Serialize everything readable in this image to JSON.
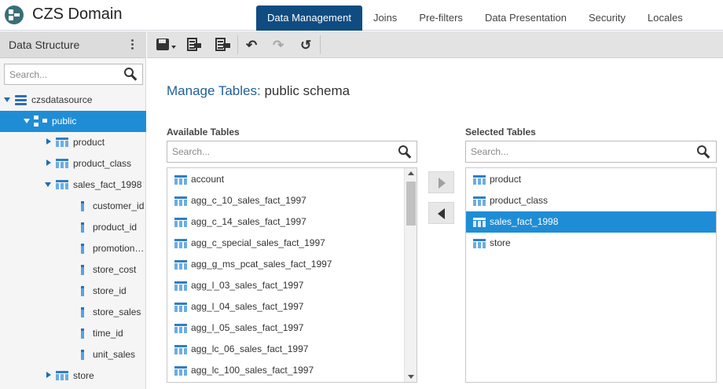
{
  "app": {
    "title": "CZS Domain"
  },
  "tabs": [
    {
      "label": "Data Management",
      "active": true
    },
    {
      "label": "Joins",
      "active": false
    },
    {
      "label": "Pre-filters",
      "active": false
    },
    {
      "label": "Data Presentation",
      "active": false
    },
    {
      "label": "Security",
      "active": false
    },
    {
      "label": "Locales",
      "active": false
    }
  ],
  "sidebar": {
    "title": "Data Structure",
    "search_placeholder": "Search...",
    "tree": [
      {
        "label": "czsdatasource",
        "type": "datasource",
        "expanded": true
      },
      {
        "label": "public",
        "type": "schema",
        "expanded": true,
        "selected": true
      },
      {
        "label": "product",
        "type": "table",
        "expanded": false
      },
      {
        "label": "product_class",
        "type": "table",
        "expanded": false
      },
      {
        "label": "sales_fact_1998",
        "type": "table",
        "expanded": true
      },
      {
        "label": "customer_id",
        "type": "column"
      },
      {
        "label": "product_id",
        "type": "column"
      },
      {
        "label": "promotion_id",
        "type": "column"
      },
      {
        "label": "store_cost",
        "type": "column"
      },
      {
        "label": "store_id",
        "type": "column"
      },
      {
        "label": "store_sales",
        "type": "column"
      },
      {
        "label": "time_id",
        "type": "column"
      },
      {
        "label": "unit_sales",
        "type": "column"
      },
      {
        "label": "store",
        "type": "table",
        "expanded": false
      }
    ]
  },
  "toolbar": {
    "buttons": [
      "save-icon",
      "export-icon",
      "import-icon",
      "undo-icon",
      "redo-icon",
      "revert-icon"
    ]
  },
  "main": {
    "title_key": "Manage Tables:",
    "title_value": "public schema",
    "available": {
      "label": "Available Tables",
      "search_placeholder": "Search...",
      "items": [
        "account",
        "agg_c_10_sales_fact_1997",
        "agg_c_14_sales_fact_1997",
        "agg_c_special_sales_fact_1997",
        "agg_g_ms_pcat_sales_fact_1997",
        "agg_l_03_sales_fact_1997",
        "agg_l_04_sales_fact_1997",
        "agg_l_05_sales_fact_1997",
        "agg_lc_06_sales_fact_1997",
        "agg_lc_100_sales_fact_1997"
      ]
    },
    "selected": {
      "label": "Selected Tables",
      "search_placeholder": "Search...",
      "items": [
        "product",
        "product_class",
        "sales_fact_1998",
        "store"
      ],
      "selected_index": 2
    }
  },
  "colors": {
    "brand": "#0f4c81",
    "selection": "#1f8dd6",
    "link": "#1f5f99"
  }
}
